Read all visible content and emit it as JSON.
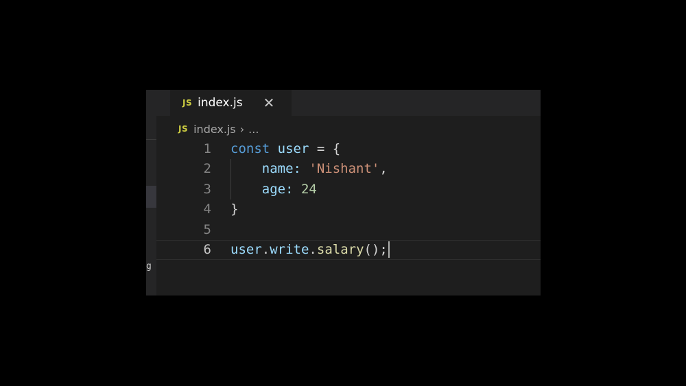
{
  "tab": {
    "badge": "JS",
    "filename": "index.js",
    "close": "✕"
  },
  "breadcrumb": {
    "badge": "JS",
    "file": "index.js",
    "separator": "›",
    "more": "..."
  },
  "sidebar": {
    "fragment": "g"
  },
  "code": {
    "lines": [
      {
        "number": "1",
        "tokens": [
          "const",
          " ",
          "user",
          " = {"
        ]
      },
      {
        "number": "2",
        "tokens": [
          "    name: ",
          "'Nishant'",
          ","
        ]
      },
      {
        "number": "3",
        "tokens": [
          "    age: ",
          "24"
        ]
      },
      {
        "number": "4",
        "tokens": [
          "}"
        ]
      },
      {
        "number": "5",
        "tokens": []
      },
      {
        "number": "6",
        "tokens": [
          "user",
          ".",
          "write",
          ".",
          "salary",
          "();"
        ]
      }
    ]
  },
  "colors": {
    "background": "#000000",
    "editor": "#1e1e1e",
    "keyword": "#569cd6",
    "variable": "#9cdcfe",
    "function": "#dcdcaa",
    "string": "#ce9178",
    "number": "#b5cea8",
    "js_badge": "#cbcb41"
  }
}
